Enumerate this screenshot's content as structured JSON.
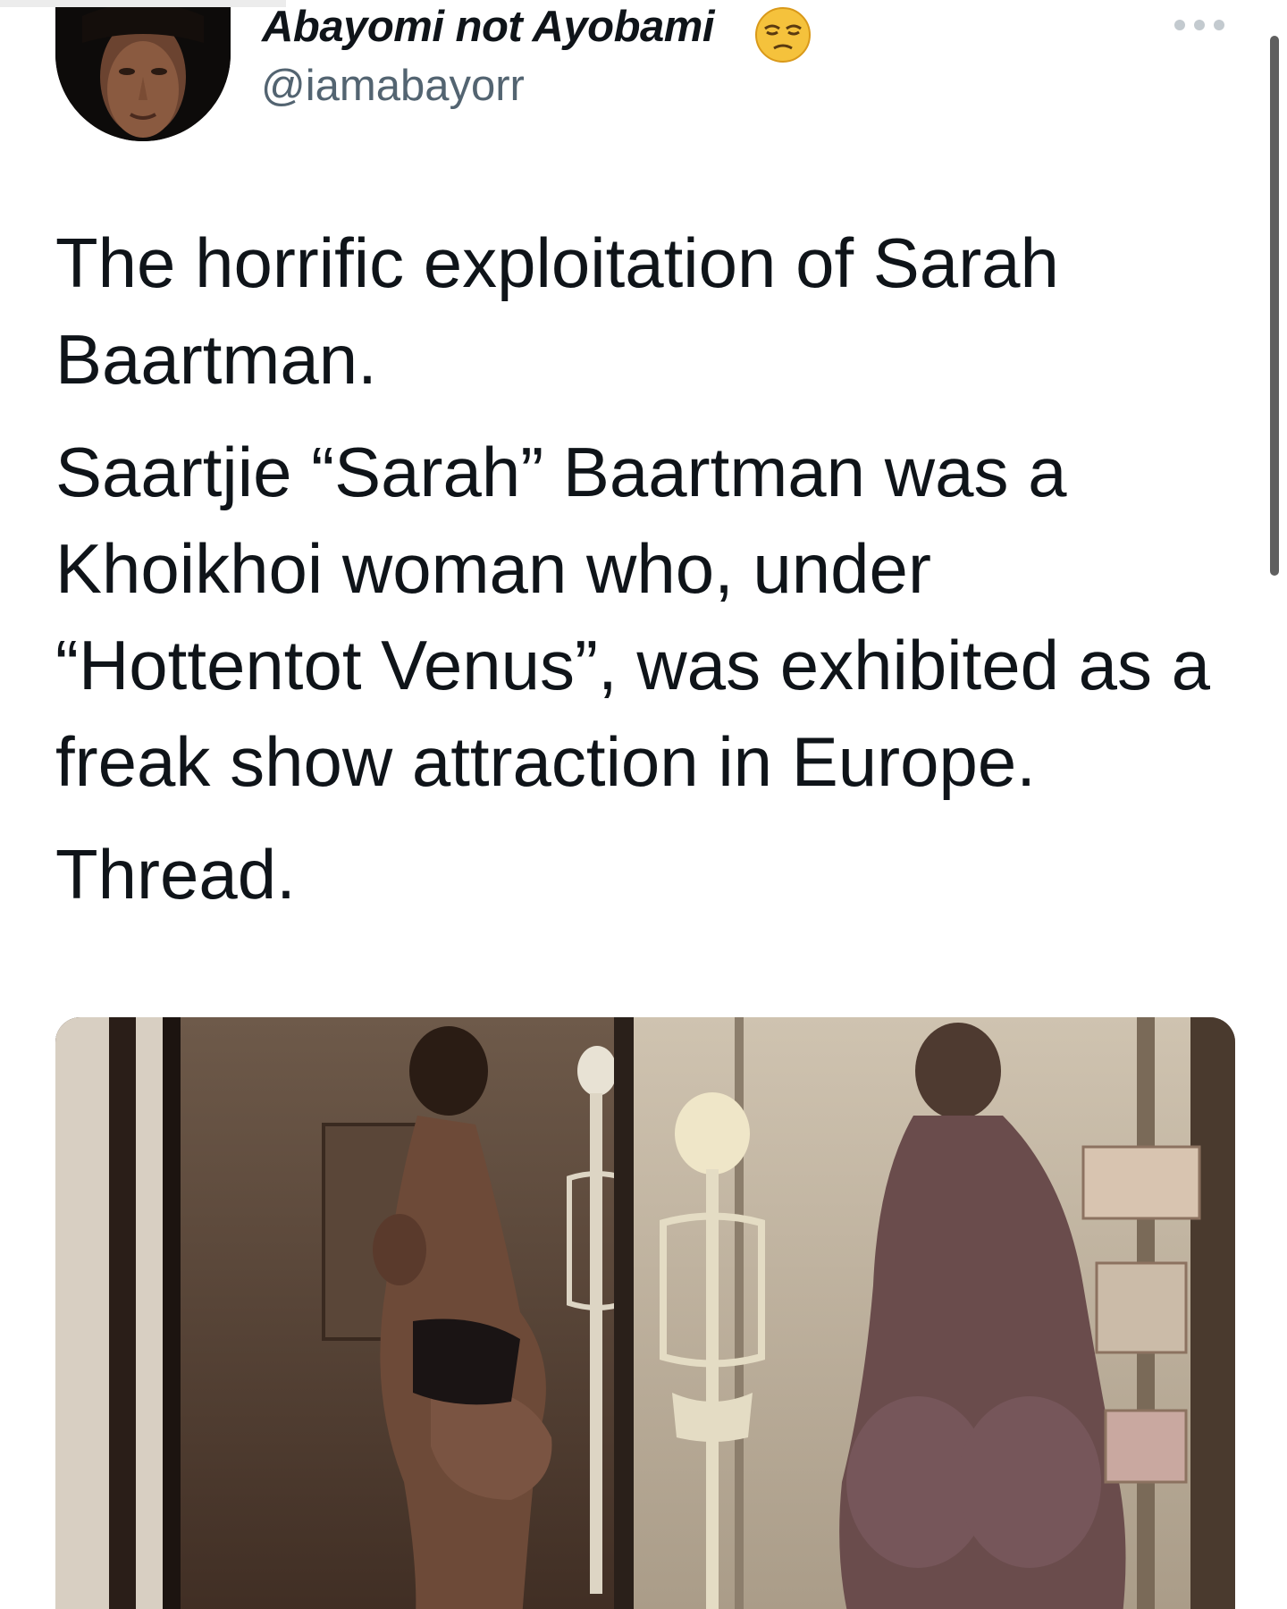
{
  "tweet": {
    "author": {
      "display_name": "Abayomi not Ayobami",
      "handle": "@iamabayorr",
      "name_emoji": "unamused-face-emoji",
      "avatar": "profile-photo-avatar"
    },
    "menu_icon": "more-options-icon",
    "text": {
      "paragraph_1": "The horrific exploitation of Sarah Baartman.",
      "paragraph_2": "Saartjie “Sarah” Baartman was a Khoikhoi woman who, under “Hottentot Venus”, was exhibited as a freak show attraction in Europe.",
      "paragraph_3": "Thread."
    },
    "media": {
      "kind": "photo",
      "panels": [
        "left-panel-sepia-figure-with-skeleton",
        "right-panel-museum-display-with-skeleton"
      ]
    }
  }
}
